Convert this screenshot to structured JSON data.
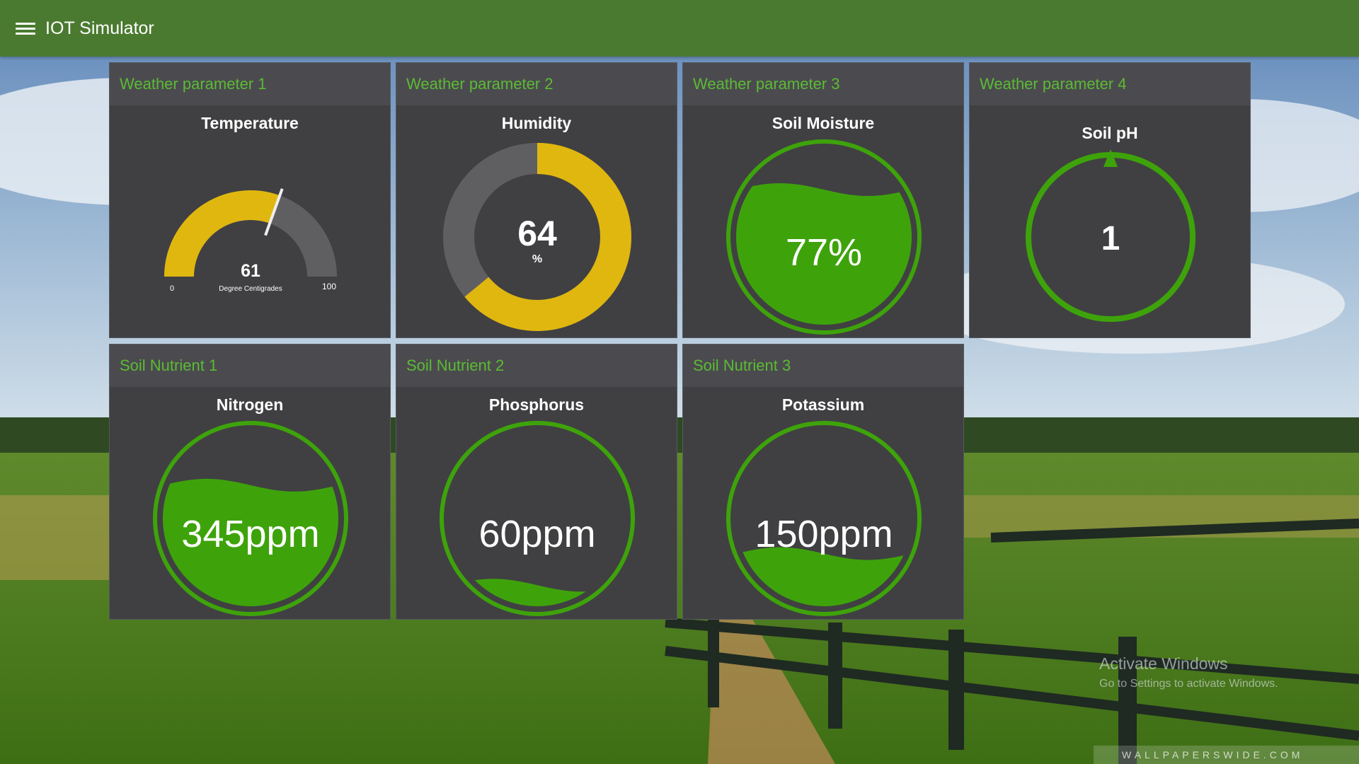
{
  "app": {
    "title": "IOT Simulator"
  },
  "widgets": {
    "temperature": {
      "header": "Weather parameter 1",
      "title": "Temperature",
      "value": "61",
      "unit": "Degree Centigrades",
      "min": "0",
      "max": "100",
      "level": 0.61
    },
    "humidity": {
      "header": "Weather parameter 2",
      "title": "Humidity",
      "value": "64",
      "unit": "%",
      "level": 0.64
    },
    "soil_moisture": {
      "header": "Weather parameter 3",
      "title": "Soil Moisture",
      "value": "77%",
      "level": 0.77
    },
    "soil_ph": {
      "header": "Weather parameter 4",
      "title": "Soil pH",
      "value": "1"
    },
    "nitrogen": {
      "header": "Soil Nutrient 1",
      "title": "Nitrogen",
      "value": "345ppm",
      "level": 0.69
    },
    "phosphorus": {
      "header": "Soil Nutrient 2",
      "title": "Phosphorus",
      "value": "60ppm",
      "level": 0.12
    },
    "potassium": {
      "header": "Soil Nutrient 3",
      "title": "Potassium",
      "value": "150ppm",
      "level": 0.3
    }
  },
  "watermark": {
    "activate_title": "Activate Windows",
    "activate_sub": "Go to Settings to activate Windows.",
    "site": "WALLPAPERSWIDE.COM"
  },
  "colors": {
    "app_bar": "#4a7a30",
    "header_text": "#5bbb33",
    "panel": "#404042",
    "gauge_fill": "#e0b70f",
    "gauge_track": "#5f5f61",
    "liquid": "#3ea30b"
  }
}
